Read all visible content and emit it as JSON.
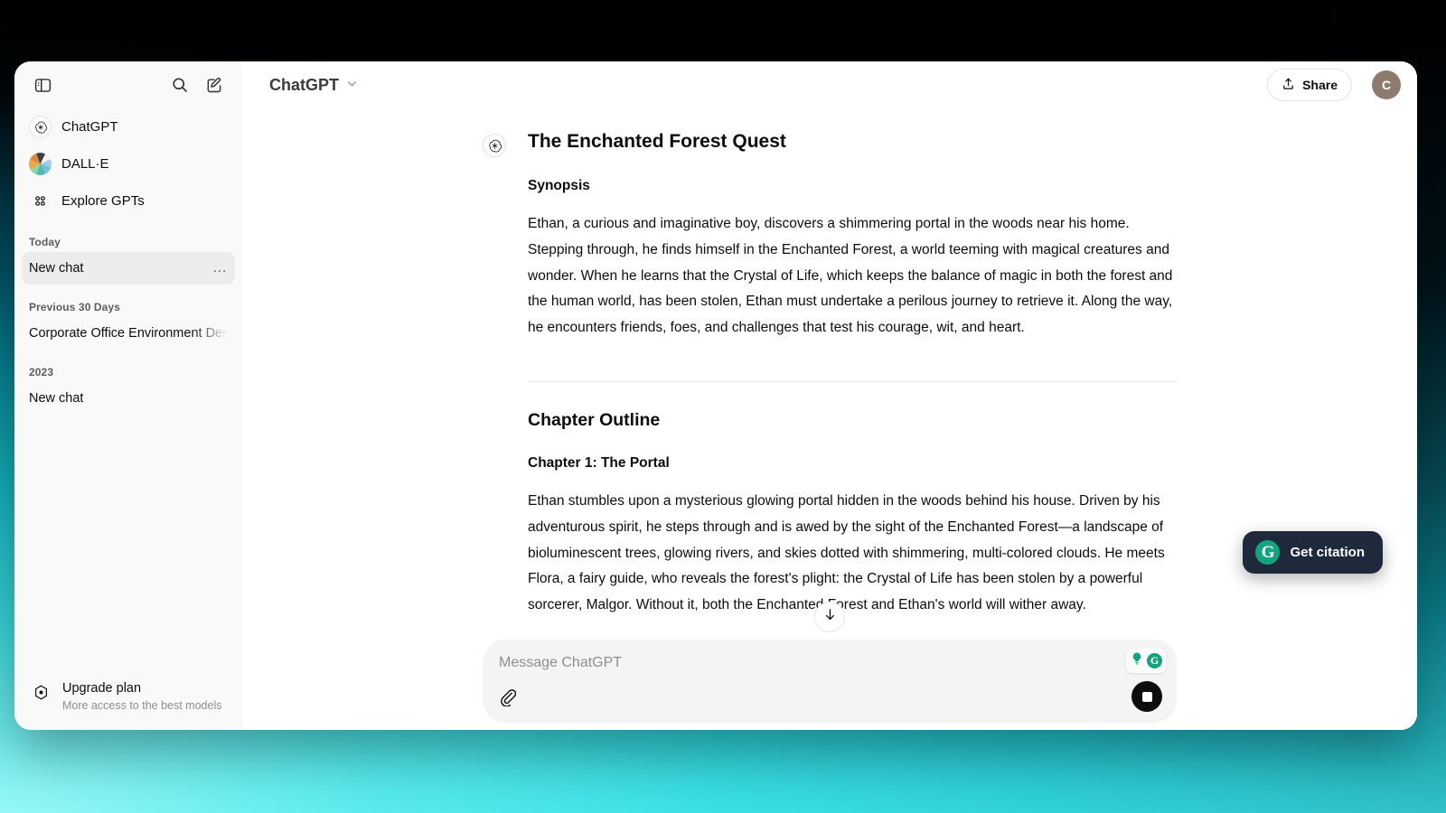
{
  "window": {
    "sidebar": {
      "toggle_icon": "sidebar-toggle-icon",
      "search_icon": "search-icon",
      "new_chat_icon": "new-chat-pencil-icon",
      "nav": [
        {
          "label": "ChatGPT",
          "icon": "openai-logo-icon"
        },
        {
          "label": "DALL·E",
          "icon": "dalle-color-wheel-icon"
        },
        {
          "label": "Explore GPTs",
          "icon": "grid-dots-icon"
        }
      ],
      "groups": [
        {
          "label": "Today",
          "chats": [
            {
              "title": "New chat",
              "active": true,
              "menu": "…"
            }
          ]
        },
        {
          "label": "Previous 30 Days",
          "chats": [
            {
              "title": "Corporate Office Environment Design",
              "active": false,
              "menu": ""
            }
          ]
        },
        {
          "label": "2023",
          "chats": [
            {
              "title": "New chat",
              "active": false,
              "menu": ""
            }
          ]
        }
      ],
      "upgrade": {
        "title": "Upgrade plan",
        "subtitle": "More access to the best models",
        "icon": "upgrade-diamond-icon"
      }
    },
    "topbar": {
      "model": "ChatGPT",
      "model_chevron": "chevron-down-icon",
      "share_label": "Share",
      "share_icon": "share-upload-icon",
      "avatar_initial": "C"
    },
    "conversation": {
      "assistant_icon": "openai-logo-icon",
      "title": "The Enchanted Forest Quest",
      "synopsis_heading": "Synopsis",
      "synopsis_body": "Ethan, a curious and imaginative boy, discovers a shimmering portal in the woods near his home. Stepping through, he finds himself in the Enchanted Forest, a world teeming with magical creatures and wonder. When he learns that the Crystal of Life, which keeps the balance of magic in both the forest and the human world, has been stolen, Ethan must undertake a perilous journey to retrieve it. Along the way, he encounters friends, foes, and challenges that test his courage, wit, and heart.",
      "outline_heading": "Chapter Outline",
      "chapter_heading": "Chapter 1: The Portal",
      "chapter_body": "Ethan stumbles upon a mysterious glowing portal hidden in the woods behind his house. Driven by his adventurous spirit, he steps through and is awed by the sight of the Enchanted Forest—a landscape of bioluminescent trees, glowing rivers, and skies dotted with shimmering, multi-colored clouds. He meets Flora, a fairy guide, who reveals the forest's plight: the Crystal of Life has been stolen by a powerful sorcerer, Malgor. Without it, both the Enchanted Forest and Ethan's world will wither away.",
      "scroll_button_icon": "arrow-down-icon"
    },
    "composer": {
      "placeholder": "Message ChatGPT",
      "attach_icon": "paperclip-icon",
      "stop_icon": "stop-square-icon",
      "assist_icons": [
        {
          "icon": "lightbulb-icon",
          "color": "#15a37f"
        },
        {
          "icon": "grammarly-g-icon",
          "label": "G",
          "color": "#15a37f"
        }
      ]
    },
    "citation_widget": {
      "label": "Get citation",
      "logo_letter": "G",
      "logo_color": "#15a37f",
      "background": "#1e293b"
    }
  }
}
